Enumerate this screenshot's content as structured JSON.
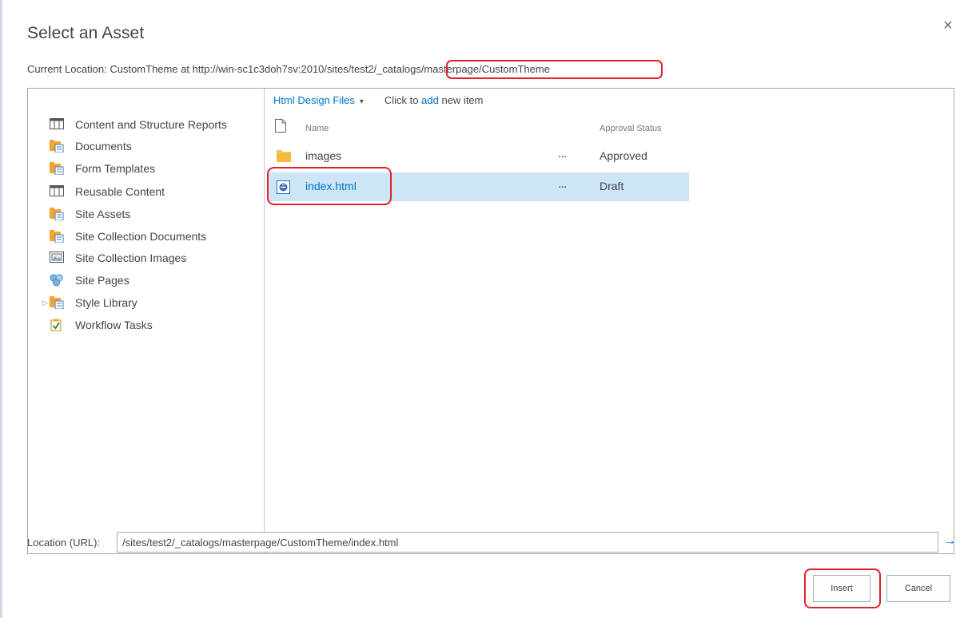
{
  "dialog": {
    "title": "Select an Asset",
    "close_glyph": "×",
    "current_location_prefix": "Current Location: CustomTheme at http://win-sc1c3doh7sv:2010/sites/test2/",
    "current_location_highlight": "_catalogs/masterpage/CustomTheme"
  },
  "tree": {
    "items": [
      {
        "label": "Content and Structure Reports",
        "icon": "list-icon"
      },
      {
        "label": "Documents",
        "icon": "library-icon"
      },
      {
        "label": "Form Templates",
        "icon": "library-icon"
      },
      {
        "label": "Reusable Content",
        "icon": "list-icon"
      },
      {
        "label": "Site Assets",
        "icon": "library-icon"
      },
      {
        "label": "Site Collection Documents",
        "icon": "library-icon"
      },
      {
        "label": "Site Collection Images",
        "icon": "image-library-icon"
      },
      {
        "label": "Site Pages",
        "icon": "site-pages-icon"
      },
      {
        "label": "Style Library",
        "icon": "library-icon",
        "expander": "▷"
      },
      {
        "label": "Workflow Tasks",
        "icon": "tasks-icon"
      }
    ]
  },
  "content": {
    "view_name": "Html Design Files",
    "view_caret": "▾",
    "add_prefix": "Click to",
    "add_link": "add",
    "add_suffix": "new item",
    "columns": {
      "name": "Name",
      "approval": "Approval Status"
    },
    "rows": [
      {
        "name": "images",
        "ellipsis": "...",
        "status": "Approved",
        "type": "folder-icon"
      },
      {
        "name": "index.html",
        "ellipsis": "...",
        "status": "Draft",
        "type": "html-file-icon"
      }
    ]
  },
  "footer": {
    "location_label": "Location (URL):",
    "location_value": "/sites/test2/_catalogs/masterpage/CustomTheme/index.html",
    "go_glyph": "→",
    "insert_label": "Insert",
    "cancel_label": "Cancel"
  },
  "colors": {
    "link": "#0072c6",
    "selected_row": "#cde6f7",
    "highlight_box": "#e0202a"
  }
}
